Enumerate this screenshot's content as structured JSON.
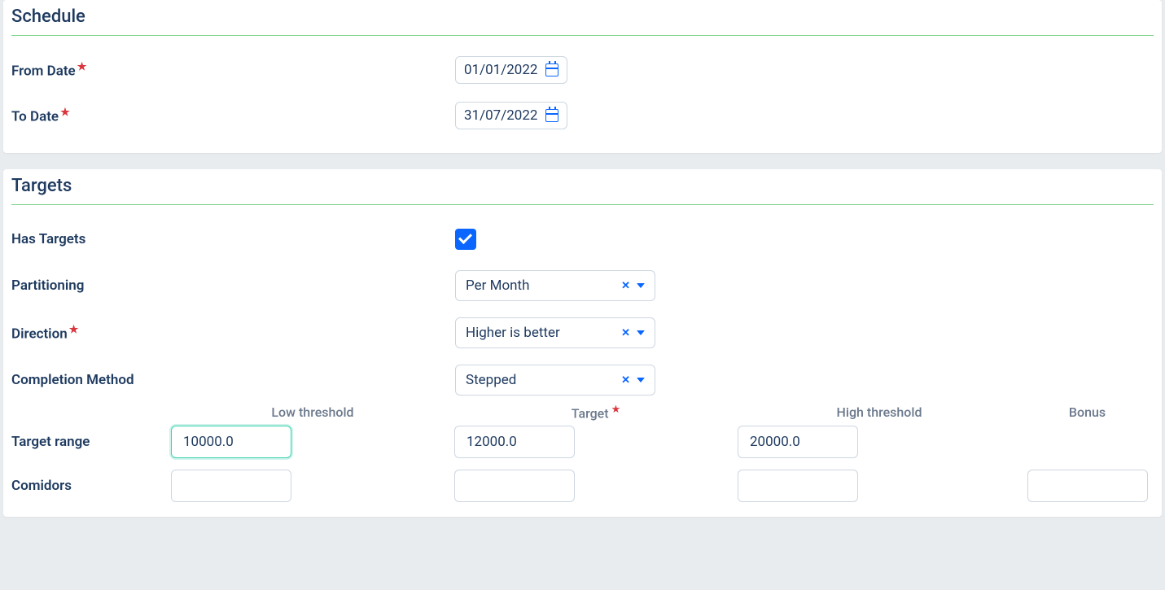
{
  "schedule": {
    "title": "Schedule",
    "from_label": "From Date",
    "from_value": "01/01/2022",
    "to_label": "To Date",
    "to_value": "31/07/2022"
  },
  "targets": {
    "title": "Targets",
    "has_targets_label": "Has Targets",
    "has_targets_value": true,
    "partitioning_label": "Partitioning",
    "partitioning_value": "Per Month",
    "direction_label": "Direction",
    "direction_value": "Higher is better",
    "completion_label": "Completion Method",
    "completion_value": "Stepped",
    "headers": {
      "low": "Low threshold",
      "target": "Target",
      "high": "High threshold",
      "bonus": "Bonus"
    },
    "rows": {
      "target_range": {
        "label": "Target range",
        "low": "10000.0",
        "target": "12000.0",
        "high": "20000.0",
        "bonus": ""
      },
      "comidors": {
        "label": "Comidors",
        "low": "",
        "target": "",
        "high": "",
        "bonus": ""
      }
    }
  }
}
